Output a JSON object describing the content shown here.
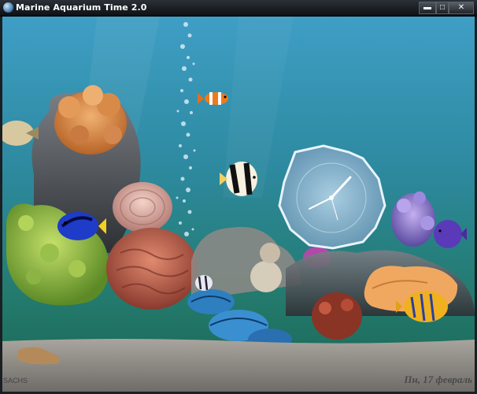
{
  "window": {
    "title": "Marine Aquarium Time 2.0",
    "controls": {
      "minimize": "▬",
      "maximize": "□",
      "close": "✕"
    }
  },
  "aquarium": {
    "footer_left": "SACHS",
    "footer_right": "Пн, 17 февраль"
  },
  "colors": {
    "water_top": "#3f9ec5",
    "water_bottom": "#1a6553",
    "sand": "#8a8a8a"
  }
}
